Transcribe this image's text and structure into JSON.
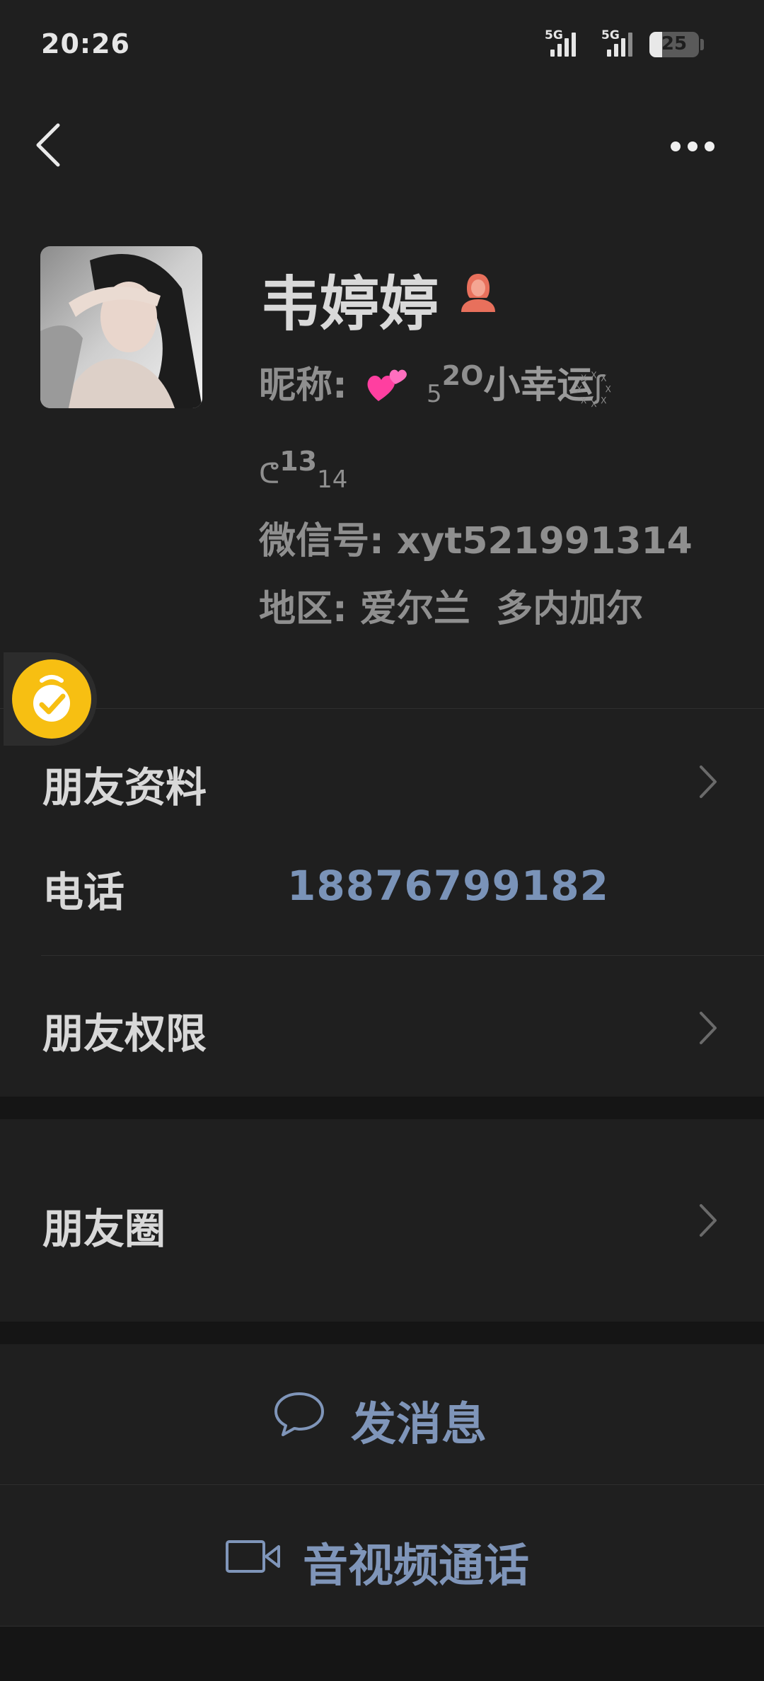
{
  "status_bar": {
    "time": "20:26",
    "network_1": "5G",
    "network_2": "5G",
    "battery_level": "25",
    "battery_fraction": 0.25
  },
  "nav": {
    "back_icon": "chevron-left-icon",
    "more_icon": "more-dots-icon"
  },
  "profile": {
    "display_name": "韦婷婷",
    "gender_icon": "female-user-icon",
    "nickname_label": "昵称:",
    "nickname_emoji": "💞",
    "nickname_sub_1": "5",
    "nickname_sup_1": "2O",
    "nickname_text": "小幸运",
    "nickname_tail": "꙰ʃ",
    "nickname_line2_lead": "ᕦ",
    "nickname_line2_sup": "13",
    "nickname_line2_sub": "14",
    "wechat_id_label": "微信号:",
    "wechat_id": "xyt521991314",
    "region_label": "地区:",
    "region": "爱尔兰  多内加尔"
  },
  "rows": {
    "friend_info": "朋友资料",
    "phone_label": "电话",
    "phone_value": "18876799182",
    "friend_permissions": "朋友权限",
    "moments": "朋友圈"
  },
  "actions": {
    "send_message": "发消息",
    "send_message_icon": "chat-bubble-icon",
    "av_call": "音视频通话",
    "av_call_icon": "video-camera-icon"
  },
  "colors": {
    "background": "#1f1f1f",
    "section_gap": "#151515",
    "link_blue": "#7a93b8",
    "assistant_yellow": "#f7bf12"
  }
}
